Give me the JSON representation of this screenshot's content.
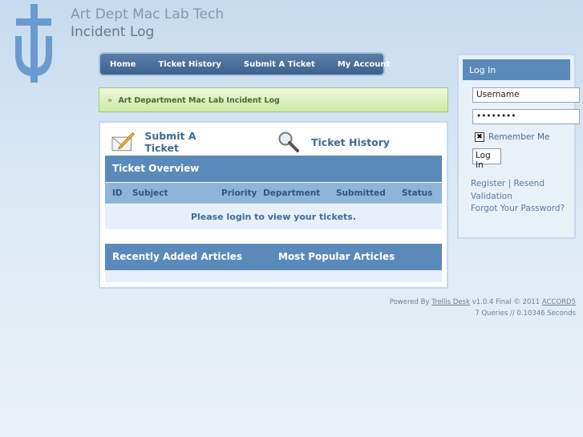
{
  "header": {
    "title": "Art Dept Mac Lab Tech",
    "subtitle": "Incident Log",
    "logo_icon": "cross-anchor-logo-icon"
  },
  "nav": {
    "items": [
      {
        "label": "Home"
      },
      {
        "label": "Ticket History"
      },
      {
        "label": "Submit A Ticket"
      },
      {
        "label": "My Account"
      }
    ]
  },
  "breadcrumb": {
    "separator": "»",
    "text": "Art Department Mac Lab Incident Log"
  },
  "actions": {
    "submit_label": "Submit A Ticket",
    "submit_icon": "envelope-pencil-icon",
    "history_label": "Ticket History",
    "history_icon": "magnifier-icon"
  },
  "ticket_overview": {
    "title": "Ticket Overview",
    "columns": [
      "ID",
      "Subject",
      "Priority",
      "Department",
      "Submitted",
      "Status"
    ],
    "empty_message": "Please login to view your tickets."
  },
  "articles": {
    "recent_title": "Recently Added Articles",
    "popular_title": "Most Popular Articles"
  },
  "login": {
    "title": "Log In",
    "username_value": "Username",
    "password_value": "••••••••",
    "remember_label": "Remember Me",
    "remember_checked": "✖",
    "button_label": "Log In",
    "register_label": "Register",
    "resend_label": "Resend Validation",
    "forgot_label": "Forgot Your Password?"
  },
  "footer": {
    "powered_prefix": "Powered By ",
    "powered_link": "Trellis Desk",
    "version": " v1.0.4 Final © 2011 ",
    "company_link": "ACCORD5",
    "stats": "7 Queries // 0.10346 Seconds"
  },
  "colors": {
    "nav_bg": "#3c628f",
    "bar_bg": "#5a8ab9",
    "breadcrumb_bg": "#cfe9a6"
  }
}
